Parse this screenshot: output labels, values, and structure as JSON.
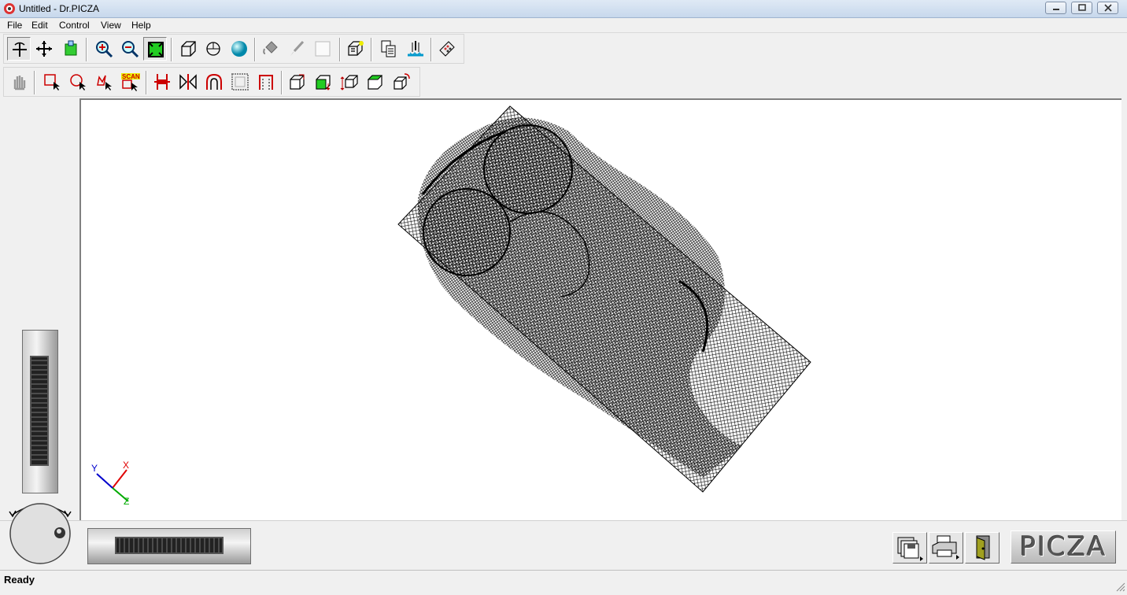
{
  "window": {
    "title": "Untitled - Dr.PICZA"
  },
  "menu": {
    "items": [
      "File",
      "Edit",
      "Control",
      "View",
      "Help"
    ]
  },
  "toolbar1": {
    "tools": [
      "rotate-icon",
      "move-icon",
      "layer-icon",
      "zoom-in-icon",
      "zoom-out-icon",
      "fit-window-icon",
      "wireframe-icon",
      "surface-icon",
      "sphere-icon",
      "paint-bucket-icon",
      "brush-icon",
      "blank-icon",
      "cube-lines-icon",
      "copy-icon",
      "mill-icon",
      "remote-icon"
    ]
  },
  "toolbar2": {
    "tools": [
      "hand-icon",
      "rect-select-icon",
      "circle-select-icon",
      "lasso-select-icon",
      "scan-select-icon",
      "split-icon",
      "mirror-icon",
      "arch-icon",
      "grid-frame-icon",
      "bracket-icon",
      "box-front-icon",
      "box-green-icon",
      "box-resize-icon",
      "box-green-2-icon",
      "box-rotate-icon"
    ],
    "scan_badge": "SCAN"
  },
  "axes": {
    "x": "X",
    "y": "Y",
    "z": "Z",
    "colors": {
      "x": "#e00000",
      "y": "#0000cc",
      "z": "#00aa00"
    }
  },
  "status": {
    "text": "Ready"
  },
  "logo": {
    "text": "PICZA"
  },
  "actions": [
    "save-icon",
    "print-icon",
    "exit-door-icon"
  ]
}
